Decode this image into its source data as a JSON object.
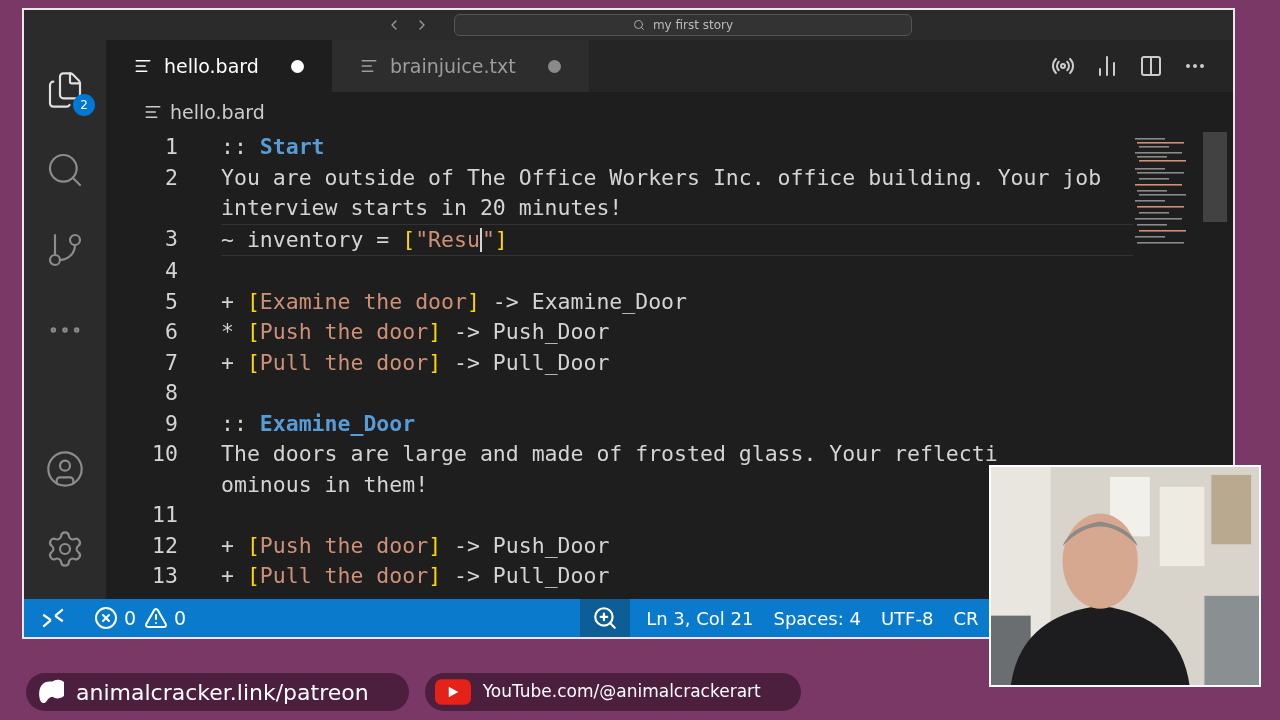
{
  "title_bar": {
    "search": "my first story"
  },
  "activity_bar": [
    {
      "kind": "files",
      "selected": true,
      "badge": "2"
    },
    {
      "kind": "search",
      "selected": false
    },
    {
      "kind": "source-control",
      "selected": false
    },
    {
      "kind": "more",
      "selected": false
    },
    {
      "kind": "account",
      "selected": false
    },
    {
      "kind": "settings",
      "selected": false
    }
  ],
  "tabs": [
    {
      "label": "hello.bard",
      "selected": true,
      "dirty": true
    },
    {
      "label": "brainjuice.txt",
      "selected": false,
      "dirty": true
    }
  ],
  "breadcrumb": "hello.bard",
  "lines": [
    {
      "number": "1",
      "current": false,
      "rows": [
        [
          {
            "kind": "op",
            "text": ":: "
          },
          {
            "kind": "heading",
            "text": "Start"
          }
        ]
      ]
    },
    {
      "number": "2",
      "current": false,
      "rows": [
        [
          {
            "kind": "plain",
            "text": "You are outside of The Office Workers Inc. office building. Your job"
          }
        ],
        [
          {
            "kind": "plain",
            "text": "interview starts in 20 minutes!"
          }
        ]
      ]
    },
    {
      "number": "3",
      "current": true,
      "rows": [
        [
          {
            "kind": "plain",
            "text": "~ inventory = "
          },
          {
            "kind": "bracket",
            "text": "["
          },
          {
            "kind": "string",
            "text": "\"Resu"
          },
          {
            "kind": "cursor",
            "text": ""
          },
          {
            "kind": "string",
            "text": "\""
          },
          {
            "kind": "bracket",
            "text": "]"
          }
        ]
      ]
    },
    {
      "number": "4",
      "current": false,
      "rows": [
        []
      ]
    },
    {
      "number": "5",
      "current": false,
      "rows": [
        [
          {
            "kind": "plain",
            "text": "+ "
          },
          {
            "kind": "bracket",
            "text": "["
          },
          {
            "kind": "string",
            "text": "Examine the door"
          },
          {
            "kind": "bracket",
            "text": "]"
          },
          {
            "kind": "plain",
            "text": " -> Examine_Door"
          }
        ]
      ]
    },
    {
      "number": "6",
      "current": false,
      "rows": [
        [
          {
            "kind": "plain",
            "text": "* "
          },
          {
            "kind": "bracket",
            "text": "["
          },
          {
            "kind": "string",
            "text": "Push the door"
          },
          {
            "kind": "bracket",
            "text": "]"
          },
          {
            "kind": "plain",
            "text": " -> Push_Door"
          }
        ]
      ]
    },
    {
      "number": "7",
      "current": false,
      "rows": [
        [
          {
            "kind": "plain",
            "text": "+ "
          },
          {
            "kind": "bracket",
            "text": "["
          },
          {
            "kind": "string",
            "text": "Pull the door"
          },
          {
            "kind": "bracket",
            "text": "]"
          },
          {
            "kind": "plain",
            "text": " -> Pull_Door"
          }
        ]
      ]
    },
    {
      "number": "8",
      "current": false,
      "rows": [
        []
      ]
    },
    {
      "number": "9",
      "current": false,
      "rows": [
        [
          {
            "kind": "op",
            "text": ":: "
          },
          {
            "kind": "heading",
            "text": "Examine_Door"
          }
        ]
      ]
    },
    {
      "number": "10",
      "current": false,
      "rows": [
        [
          {
            "kind": "plain",
            "text": "The doors are large and made of frosted glass. Your reflecti"
          }
        ],
        [
          {
            "kind": "plain",
            "text": "ominous in them!"
          }
        ]
      ]
    },
    {
      "number": "11",
      "current": false,
      "rows": [
        []
      ]
    },
    {
      "number": "12",
      "current": false,
      "rows": [
        [
          {
            "kind": "plain",
            "text": "+ "
          },
          {
            "kind": "bracket",
            "text": "["
          },
          {
            "kind": "string",
            "text": "Push the door"
          },
          {
            "kind": "bracket",
            "text": "]"
          },
          {
            "kind": "plain",
            "text": " -> Push_Door"
          }
        ]
      ]
    },
    {
      "number": "13",
      "current": false,
      "rows": [
        [
          {
            "kind": "plain",
            "text": "+ "
          },
          {
            "kind": "bracket",
            "text": "["
          },
          {
            "kind": "string",
            "text": "Pull the door"
          },
          {
            "kind": "bracket",
            "text": "]"
          },
          {
            "kind": "plain",
            "text": " -> Pull_Door"
          }
        ]
      ]
    }
  ],
  "status_bar": {
    "errors": "0",
    "warnings": "0",
    "items": [
      "Ln 3, Col 21",
      "Spaces: 4",
      "UTF-8",
      "CR"
    ]
  },
  "links": [
    {
      "kind": "patreon",
      "text": "animalcracker.link/patreon"
    },
    {
      "kind": "youtube",
      "text": "YouTube.com/@animalcrackerart"
    }
  ]
}
